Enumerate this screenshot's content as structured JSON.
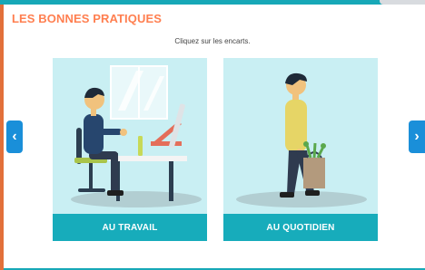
{
  "page": {
    "title": "LES BONNES PRATIQUES",
    "instruction": "Cliquez sur les encarts."
  },
  "cards": [
    {
      "label": "AU TRAVAIL",
      "illustration": "person-at-desk-illustration"
    },
    {
      "label": "AU QUOTIDIEN",
      "illustration": "person-walking-with-bag-illustration"
    }
  ],
  "nav": {
    "prev_icon": "‹",
    "next_icon": "›"
  },
  "colors": {
    "accent_teal": "#17acbb",
    "title_orange": "#ff7f50",
    "card_bg": "#c9eff3",
    "nav_blue": "#1a8fd9"
  }
}
